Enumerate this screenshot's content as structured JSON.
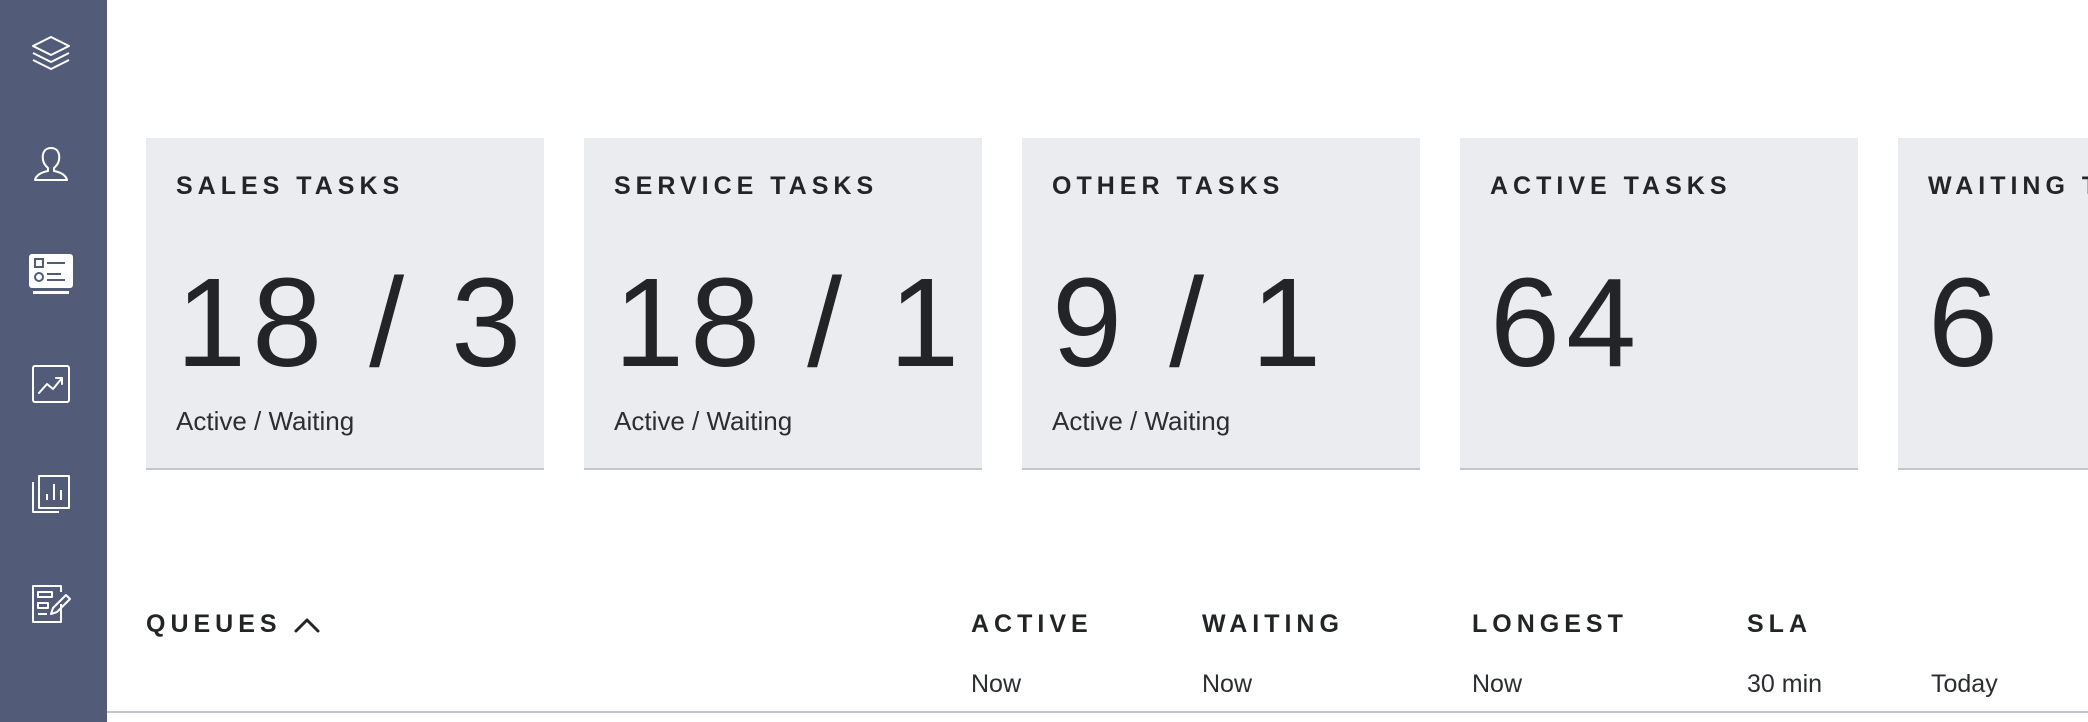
{
  "sidebar": {
    "items": [
      {
        "icon": "layers-icon"
      },
      {
        "icon": "user-icon"
      },
      {
        "icon": "task-list-icon",
        "active": true
      },
      {
        "icon": "trend-chart-icon"
      },
      {
        "icon": "report-icon"
      },
      {
        "icon": "edit-form-icon"
      }
    ],
    "background": "#525c79"
  },
  "cards": [
    {
      "title": "SALES TASKS",
      "value": "18 / 3",
      "subtitle": "Active / Waiting"
    },
    {
      "title": "SERVICE TASKS",
      "value": "18 / 1",
      "subtitle": "Active / Waiting"
    },
    {
      "title": "OTHER TASKS",
      "value": "9 / 1",
      "subtitle": "Active / Waiting"
    },
    {
      "title": "ACTIVE TASKS",
      "value": "64"
    },
    {
      "title": "WAITING TASKS",
      "value": "6"
    }
  ],
  "queues": {
    "title": "QUEUES",
    "toggle_icon": "chevron-up-icon",
    "columns": [
      {
        "header": "ACTIVE",
        "sub": "Now"
      },
      {
        "header": "WAITING",
        "sub": "Now"
      },
      {
        "header": "LONGEST",
        "sub": "Now"
      },
      {
        "header": "SLA",
        "sub": "30 min"
      },
      {
        "header": "",
        "sub": "Today"
      }
    ]
  },
  "colors": {
    "card_background": "#ebecef",
    "card_border": "#c3c6cf",
    "text": "#222426"
  }
}
